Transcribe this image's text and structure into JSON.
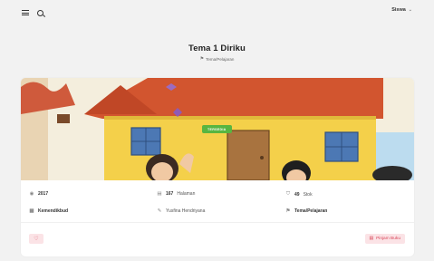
{
  "header": {
    "menu_icon": "hamburger-icon",
    "search_icon": "search-icon",
    "user_name": "Siswa"
  },
  "book": {
    "title": "Tema 1 Diriku",
    "category_path": "Tema/Pelajaran",
    "status": "TERSEDIA",
    "status_color": "#58b541",
    "year": "2017",
    "pages_count": "167",
    "pages_label": "Halaman",
    "stock_count": "49",
    "stock_label": "Stok",
    "publisher": "Kemendikbud",
    "author": "Yusfina Hendriyana",
    "category": "Tema/Pelajaran"
  },
  "actions": {
    "borrow_label": "Pinjam Buku",
    "accent_color": "#d9475a"
  }
}
